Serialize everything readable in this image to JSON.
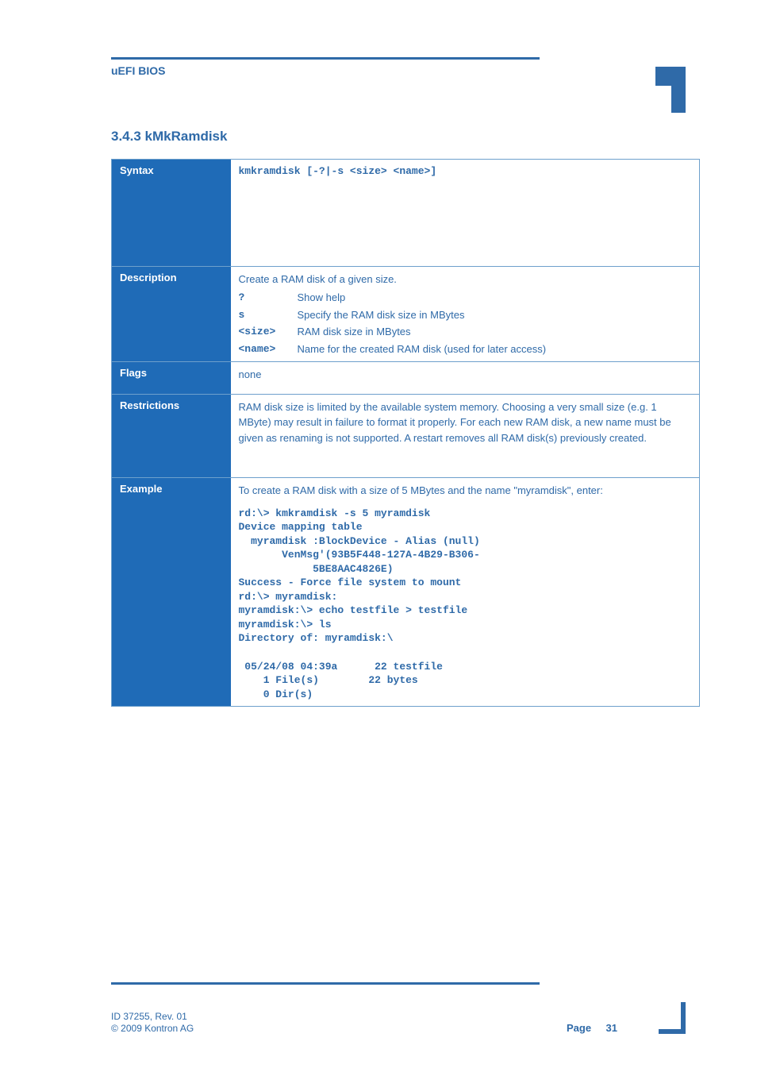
{
  "header": {
    "text": "uEFI BIOS"
  },
  "section_title": "3.4.3 kMkRamdisk",
  "table": {
    "rows": [
      {
        "label": "Syntax",
        "type": "mono",
        "content": "kmkramdisk [-?|-s <size> <name>]"
      },
      {
        "label": "Description",
        "type": "desc",
        "intro": "Create a RAM disk of a given size.",
        "options": [
          {
            "key": "?",
            "val": "Show help"
          },
          {
            "key": "s",
            "val": "Specify the RAM disk size in MBytes"
          },
          {
            "key": "<size>",
            "val": "RAM disk size in MBytes"
          },
          {
            "key": "<name>",
            "val": "Name for the created RAM disk (used for later access)"
          }
        ]
      },
      {
        "label": "Flags",
        "type": "plain",
        "content": "none"
      },
      {
        "label": "Restrictions",
        "type": "plain",
        "content": "RAM disk size is limited by the available system memory. Choosing a very small size (e.g. 1 MByte) may result in failure to format it properly. For each new RAM disk, a new name must be given as renaming is not supported. A restart removes all RAM disk(s) previously created."
      },
      {
        "label": "Example",
        "type": "example",
        "intro": "To create a RAM disk with a size of 5 MBytes and the name \"myramdisk\", enter:",
        "code": "rd:\\> kmkramdisk -s 5 myramdisk\nDevice mapping table\n  myramdisk :BlockDevice - Alias (null)\n       VenMsg'(93B5F448-127A-4B29-B306-\n            5BE8AAC4826E)\nSuccess - Force file system to mount\nrd:\\> myramdisk:\nmyramdisk:\\> echo testfile > testfile\nmyramdisk:\\> ls\nDirectory of: myramdisk:\\\n\n 05/24/08 04:39a      22 testfile\n    1 File(s)        22 bytes\n    0 Dir(s)"
      }
    ]
  },
  "footer": {
    "id": "ID 37255, Rev. 01",
    "copyright": "© 2009 Kontron AG",
    "page_label": "Page",
    "page_num": "31"
  }
}
